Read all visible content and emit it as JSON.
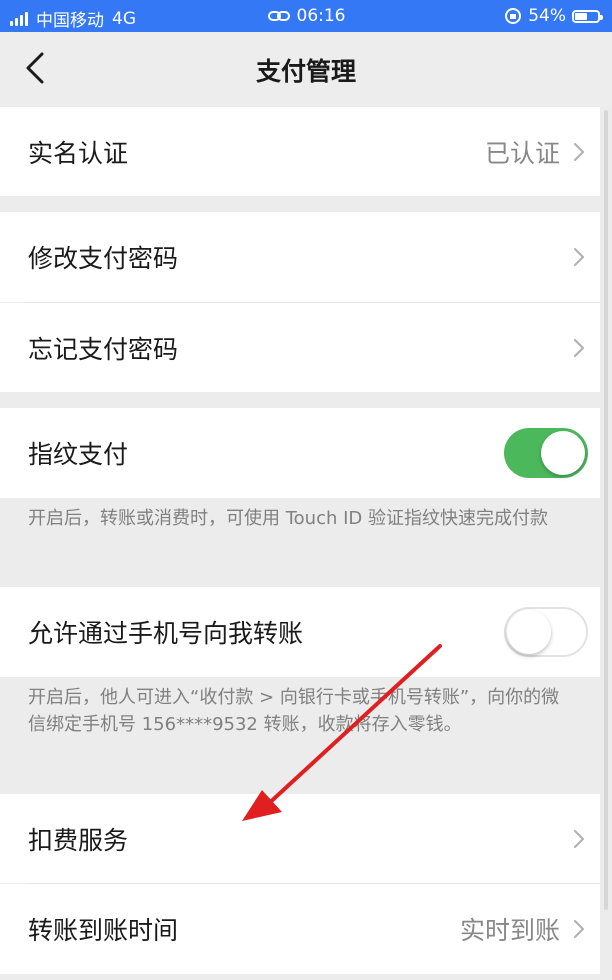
{
  "status_bar": {
    "carrier": "中国移动",
    "network": "4G",
    "time": "06:16",
    "battery": "54%",
    "battery_level": 0.54
  },
  "nav": {
    "title": "支付管理"
  },
  "rows": {
    "real_name": {
      "label": "实名认证",
      "value": "已认证"
    },
    "change_pw": {
      "label": "修改支付密码"
    },
    "forgot_pw": {
      "label": "忘记支付密码"
    },
    "fingerprint": {
      "label": "指纹支付",
      "enabled": true,
      "note": "开启后，转账或消费时，可使用 Touch ID 验证指纹快速完成付款"
    },
    "phone_transfer": {
      "label": "允许通过手机号向我转账",
      "enabled": false,
      "note": "开启后，他人可进入“收付款 > 向银行卡或手机号转账”，向你的微信绑定手机号 156****9532 转账，收款将存入零钱。"
    },
    "deduction": {
      "label": "扣费服务"
    },
    "arrival_time": {
      "label": "转账到账时间",
      "value": "实时到账"
    }
  },
  "colors": {
    "status_bar": "#3478f6",
    "toggle_on": "#4cb85c",
    "annotation_arrow": "#e02020"
  }
}
